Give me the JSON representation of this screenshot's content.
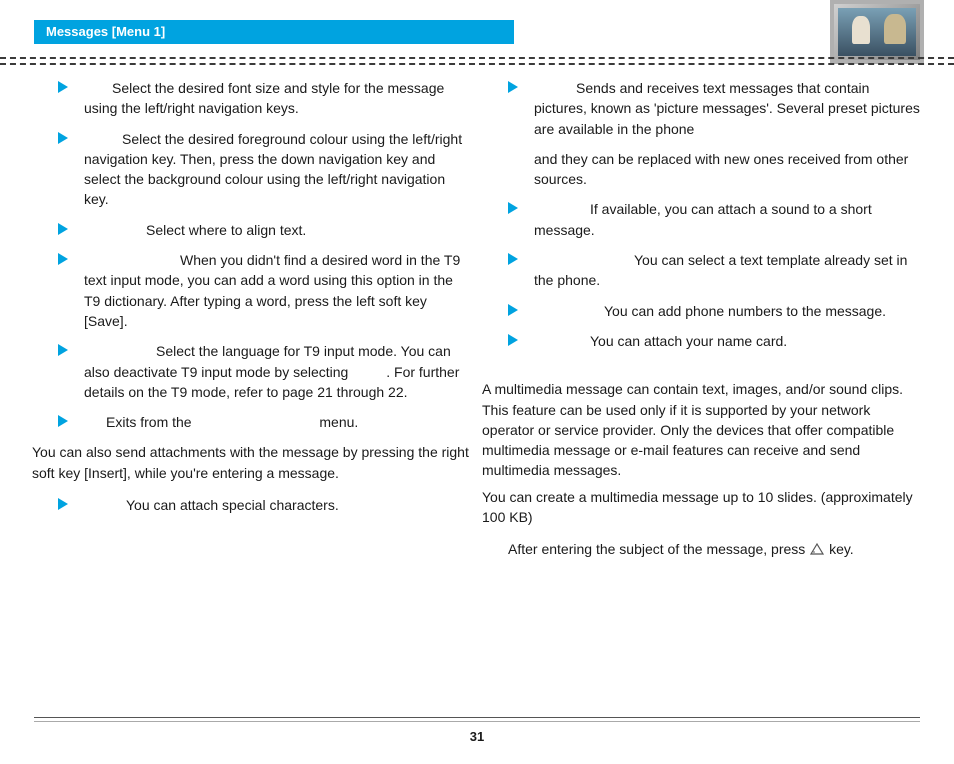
{
  "header": {
    "title": "Messages [Menu 1]"
  },
  "left": {
    "b1": "Select the desired font size and style for the message using the left/right navigation keys.",
    "b2": "Select the desired foreground colour using the left/right navigation key. Then, press the down navigation key and select the background colour using the left/right navigation key.",
    "b3": "Select where to align text.",
    "b4": "When you didn't find a desired word in the T9 text input mode, you can add a word using this option in the T9 dictionary. After typing a word, press the left soft key [Save].",
    "b5a": "Select the language for T9 input mode. You can also deactivate T9 input mode by selecting",
    "b5b": ". For further details on the T9 mode, refer to page 21 through 22.",
    "b6a": "Exits from the",
    "b6b": "menu.",
    "p1": "You can also send attachments with the message by pressing the right soft key [Insert], while you're entering a message.",
    "b7": "You can attach special characters.",
    "b8": "Sends and receives text messages that contain pictures, known as 'picture messages'. Several preset pictures are available in the phone"
  },
  "right": {
    "b8cont": "and they can be replaced with new ones received from other sources.",
    "b9": "If available, you can attach a sound to a short message.",
    "b10": "You can select a text template already set in the phone.",
    "b11": "You can add phone numbers to the message.",
    "b12": "You can attach your name card.",
    "p2": "A multimedia message can contain text, images, and/or sound clips. This feature can be used only if it is supported by your network operator or service provider. Only the devices that offer compatible multimedia message or e-mail features can receive and send multimedia messages.",
    "p3": "You can create a multimedia message up to 10 slides. (approximately 100 KB)",
    "p4a": "After entering the subject of the message, press",
    "p4b": "key."
  },
  "pageNumber": "31"
}
